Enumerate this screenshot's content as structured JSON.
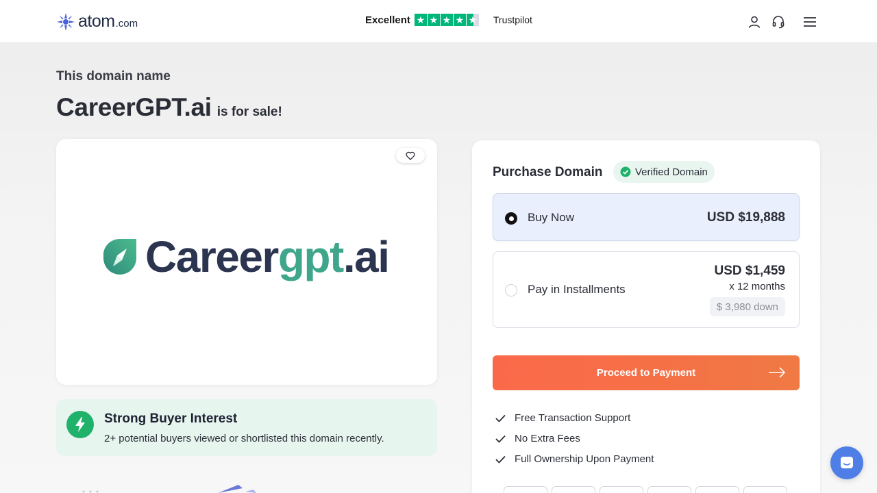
{
  "header": {
    "logo_word": "atom",
    "logo_suffix": ".com",
    "trustpilot": {
      "rating_label": "Excellent",
      "brand": "Trustpilot",
      "stars": 4.5
    },
    "icons": [
      "user-icon",
      "headset-icon",
      "menu-icon"
    ]
  },
  "hero": {
    "eyebrow": "This domain name",
    "domain": "CareerGPT.ai",
    "suffix": "is for sale!"
  },
  "preview": {
    "brand_part1": "Career",
    "brand_part2": "gpt",
    "brand_part3": ".ai",
    "favorite_icon": "heart-icon"
  },
  "interest": {
    "title": "Strong Buyer Interest",
    "subtitle": "2+ potential buyers viewed or shortlisted this domain recently.",
    "icon": "lightning-icon"
  },
  "purchase": {
    "title": "Purchase Domain",
    "verified_label": "Verified Domain",
    "options": [
      {
        "label": "Buy Now",
        "price": "USD $19,888",
        "selected": true
      },
      {
        "label": "Pay in Installments",
        "price": "USD $1,459",
        "months": "x 12 months",
        "down": "$ 3,980 down",
        "selected": false
      }
    ],
    "cta": "Proceed to Payment",
    "benefits": [
      "Free Transaction Support",
      "No Extra Fees",
      "Full Ownership Upon Payment"
    ]
  },
  "colors": {
    "accent_orange": "#fa6a4a",
    "brand_green": "#3fa68c",
    "success_green": "#20b26b",
    "trustpilot_green": "#00b67a",
    "chat_blue": "#4f7fe6"
  }
}
